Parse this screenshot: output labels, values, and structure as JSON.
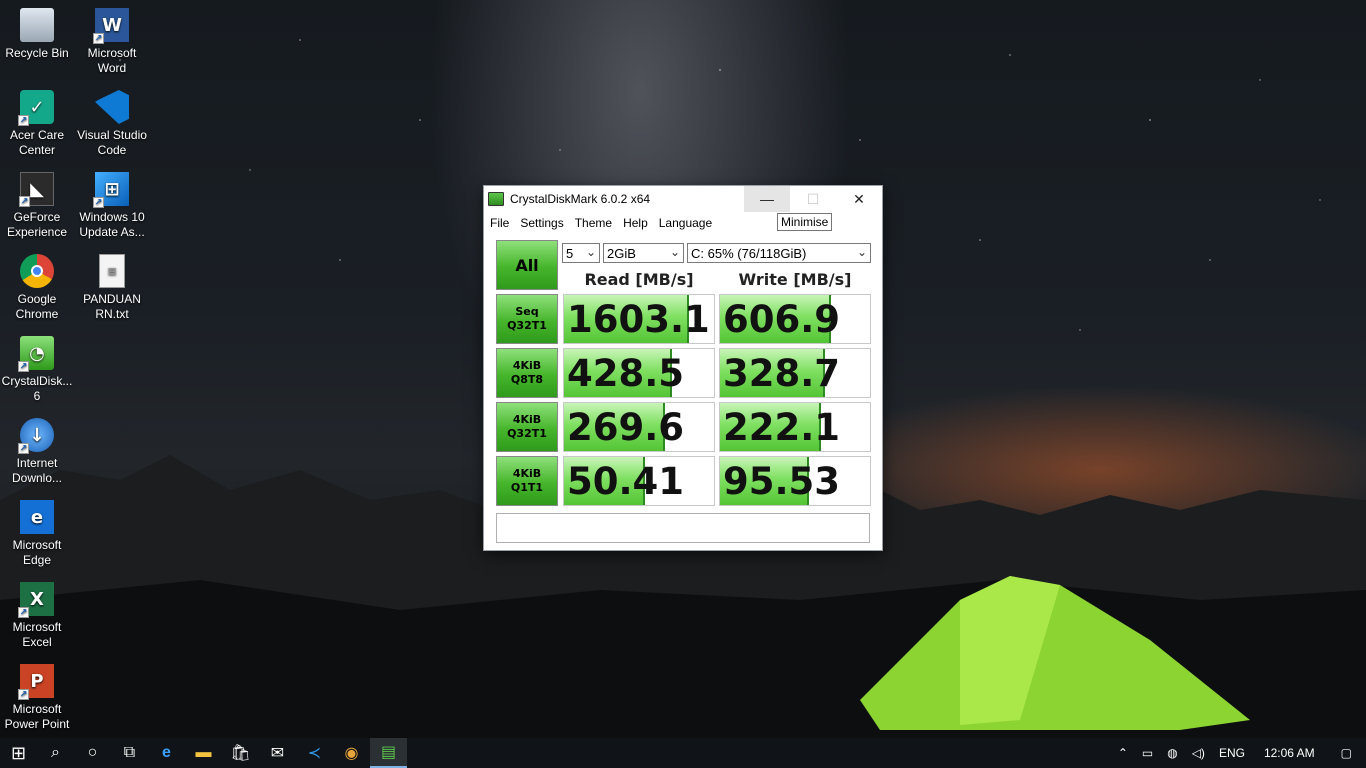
{
  "desktop_icons": [
    {
      "label": "Recycle Bin",
      "icon": "recycle-bin-icon"
    },
    {
      "label": "Microsoft Word",
      "icon": "word-icon"
    },
    {
      "label": "Acer Care Center",
      "icon": "acer-care-icon"
    },
    {
      "label": "Visual Studio Code",
      "icon": "vscode-icon"
    },
    {
      "label": "GeForce Experience",
      "icon": "geforce-icon"
    },
    {
      "label": "Windows 10 Update As...",
      "icon": "windows-update-icon"
    },
    {
      "label": "Google Chrome",
      "icon": "chrome-icon"
    },
    {
      "label": "PANDUAN RN.txt",
      "icon": "text-file-icon"
    },
    {
      "label": "CrystalDisk... 6",
      "icon": "crystaldisk-icon"
    },
    {
      "label": "Internet Downlo...",
      "icon": "idm-icon"
    },
    {
      "label": "Microsoft Edge",
      "icon": "edge-icon"
    },
    {
      "label": "Microsoft Excel",
      "icon": "excel-icon"
    },
    {
      "label": "Microsoft Power Point",
      "icon": "powerpoint-icon"
    }
  ],
  "window": {
    "title": "CrystalDiskMark 6.0.2 x64",
    "minimize_glyph": "—",
    "maximize_glyph": "☐",
    "close_glyph": "✕",
    "tooltip": "Minimise",
    "menu": [
      "File",
      "Settings",
      "Theme",
      "Help",
      "Language"
    ],
    "all_button": "All",
    "count_select": "5",
    "size_select": "2GiB",
    "drive_select": "C: 65% (76/118GiB)",
    "read_header": "Read [MB/s]",
    "write_header": "Write [MB/s]",
    "status_text": "",
    "tests": [
      {
        "line1": "Seq",
        "line2": "Q32T1",
        "read": "1603.1",
        "write": "606.9",
        "read_fill": 0.83,
        "write_fill": 0.74
      },
      {
        "line1": "4KiB",
        "line2": "Q8T8",
        "read": "428.5",
        "write": "328.7",
        "read_fill": 0.72,
        "write_fill": 0.7
      },
      {
        "line1": "4KiB",
        "line2": "Q32T1",
        "read": "269.6",
        "write": "222.1",
        "read_fill": 0.67,
        "write_fill": 0.67
      },
      {
        "line1": "4KiB",
        "line2": "Q1T1",
        "read": "50.41",
        "write": "95.53",
        "read_fill": 0.54,
        "write_fill": 0.59
      }
    ]
  },
  "taskbar": {
    "items": [
      "start-icon",
      "search-icon",
      "cortana-icon",
      "task-view-icon",
      "edge-icon",
      "file-explorer-icon",
      "store-icon",
      "mail-icon",
      "vscode-icon",
      "chrome-icon",
      "crystaldisk-icon"
    ],
    "language": "ENG",
    "time": "12:06 AM",
    "colors": {
      "accent": "#7fb3e8",
      "bar": "#101418"
    }
  }
}
